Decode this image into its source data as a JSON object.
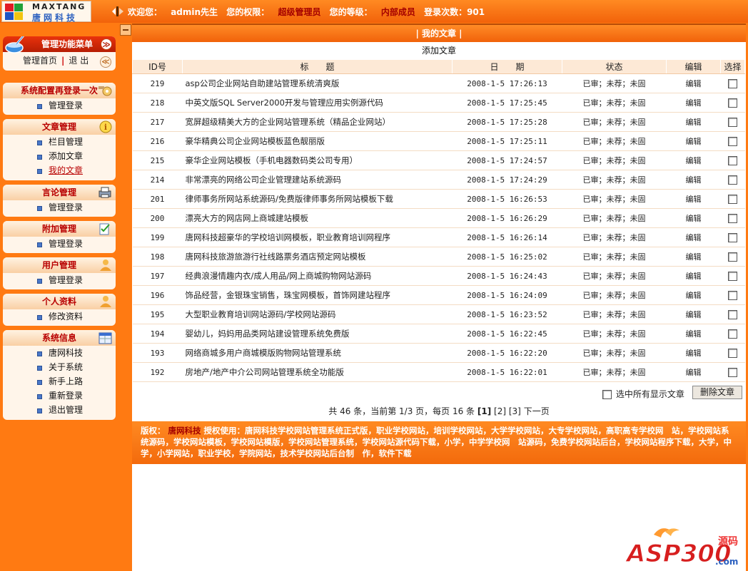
{
  "header": {
    "logo_name": "MAXTANG",
    "logo_sub": "唐网科技",
    "welcome_label": "欢迎您：",
    "username": "admin先生",
    "perm_label": "您的权限：",
    "perm_value": "超级管理员",
    "level_label": "您的等级：",
    "level_value": "内部成员",
    "login_count": "登录次数：901"
  },
  "sidebar": {
    "menu_title": "管理功能菜单",
    "home_link": "管理首页",
    "logout_link": "退 出",
    "sections": [
      {
        "title": "系统配置再登录一次",
        "icon": "gear-icon",
        "items": [
          "管理登录"
        ]
      },
      {
        "title": "文章管理",
        "icon": "info-icon",
        "items": [
          "栏目管理",
          "添加文章",
          "我的文章"
        ]
      },
      {
        "title": "言论管理",
        "icon": "printer-icon",
        "items": [
          "管理登录"
        ]
      },
      {
        "title": "附加管理",
        "icon": "checklist-icon",
        "items": [
          "管理登录"
        ]
      },
      {
        "title": "用户管理",
        "icon": "user-icon",
        "items": [
          "管理登录"
        ]
      },
      {
        "title": "个人资料",
        "icon": "user-icon",
        "items": [
          "修改资料"
        ]
      },
      {
        "title": "系统信息",
        "icon": "calendar-icon",
        "items": [
          "唐网科技",
          "关于系统",
          "新手上路",
          "重新登录",
          "退出管理"
        ]
      }
    ]
  },
  "main": {
    "title": "| 我的文章 |",
    "add_link": "添加文章",
    "columns": [
      "ID号",
      "标　　题",
      "日　　期",
      "状态",
      "编辑",
      "选择"
    ],
    "rows": [
      {
        "id": "219",
        "title": "asp公司企业网站自助建站管理系统清爽版",
        "date": "2008-1-5 17:26:13",
        "status": "已审；未荐；未固",
        "edit": "编辑"
      },
      {
        "id": "218",
        "title": "中英文版SQL Server2000开发与管理应用实例源代码",
        "date": "2008-1-5 17:25:45",
        "status": "已审；未荐；未固",
        "edit": "编辑"
      },
      {
        "id": "217",
        "title": "宽屏超级精美大方的企业网站管理系统（精品企业网站）",
        "date": "2008-1-5 17:25:28",
        "status": "已审；未荐；未固",
        "edit": "编辑"
      },
      {
        "id": "216",
        "title": "豪华精典公司企业网站模板蓝色靓丽版",
        "date": "2008-1-5 17:25:11",
        "status": "已审；未荐；未固",
        "edit": "编辑"
      },
      {
        "id": "215",
        "title": "豪华企业网站模板（手机电器数码类公司专用）",
        "date": "2008-1-5 17:24:57",
        "status": "已审；未荐；未固",
        "edit": "编辑"
      },
      {
        "id": "214",
        "title": "非常漂亮的网络公司企业管理建站系统源码",
        "date": "2008-1-5 17:24:29",
        "status": "已审；未荐；未固",
        "edit": "编辑"
      },
      {
        "id": "201",
        "title": "律师事务所网站系统源码/免费版律师事务所网站模板下载",
        "date": "2008-1-5 16:26:53",
        "status": "已审；未荐；未固",
        "edit": "编辑"
      },
      {
        "id": "200",
        "title": "漂亮大方的网店网上商城建站模板",
        "date": "2008-1-5 16:26:29",
        "status": "已审；未荐；未固",
        "edit": "编辑"
      },
      {
        "id": "199",
        "title": "唐网科技超豪华的学校培训网模板，职业教育培训网程序",
        "date": "2008-1-5 16:26:14",
        "status": "已审；未荐；未固",
        "edit": "编辑"
      },
      {
        "id": "198",
        "title": "唐网科技旅游旅游行社线路票务酒店预定网站模板",
        "date": "2008-1-5 16:25:02",
        "status": "已审；未荐；未固",
        "edit": "编辑"
      },
      {
        "id": "197",
        "title": "经典浪漫情趣内衣/成人用品/网上商城购物网站源码",
        "date": "2008-1-5 16:24:43",
        "status": "已审；未荐；未固",
        "edit": "编辑"
      },
      {
        "id": "196",
        "title": "饰品经营，金银珠宝销售，珠宝网模板，首饰网建站程序",
        "date": "2008-1-5 16:24:09",
        "status": "已审；未荐；未固",
        "edit": "编辑"
      },
      {
        "id": "195",
        "title": "大型职业教育培训网站源码/学校网站源码",
        "date": "2008-1-5 16:23:52",
        "status": "已审；未荐；未固",
        "edit": "编辑"
      },
      {
        "id": "194",
        "title": "婴幼儿，妈妈用品类网站建设管理系统免费版",
        "date": "2008-1-5 16:22:45",
        "status": "已审；未荐；未固",
        "edit": "编辑"
      },
      {
        "id": "193",
        "title": "网络商城多用户商城模版购物网站管理系统",
        "date": "2008-1-5 16:22:20",
        "status": "已审；未荐；未固",
        "edit": "编辑"
      },
      {
        "id": "192",
        "title": "房地产/地产中介公司网站管理系统全功能版",
        "date": "2008-1-5 16:22:01",
        "status": "已审；未荐；未固",
        "edit": "编辑"
      }
    ],
    "select_all_label": "选中所有显示文章",
    "delete_button": "删除文章",
    "pager": {
      "summary": "共 46 条，当前第 1/3 页，每页 16 条",
      "page1": "[1]",
      "page2": "[2]",
      "page3": "[3]",
      "next": "下一页"
    }
  },
  "footer": {
    "copyright_label": "版权：",
    "brand": "唐网科技",
    "license_text": "授权使用：唐网科技学校网站管理系统正式版，职业学校网站，培训学校网站，大学学校网站，大专学校网站，高职高专学校网　站，学校网站系统源码，学校网站模板，学校网站模版，学校网站管理系统，学校网站源代码下载，小学，中学学校网　站源码，免费学校网站后台，学校网站程序下载，大学，中学，小学网站，职业学校，学院网站，技术学校网站后台制　作，软件下载"
  },
  "watermark": {
    "text": "ASP300",
    "sub": "源码",
    "domain": ".com"
  },
  "colors": {
    "accent": "#ff7a12",
    "header_text": "#ffffff",
    "highlight": "#a40000"
  }
}
